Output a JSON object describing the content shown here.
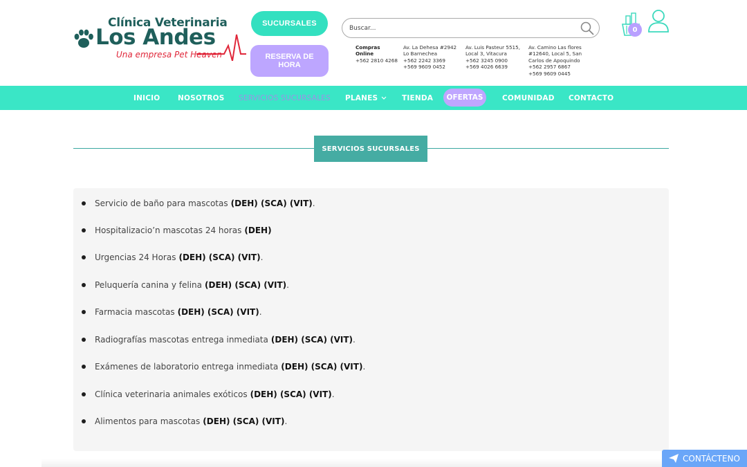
{
  "brand": {
    "line1": "Clínica Veterinaria",
    "line2": "Los Andes",
    "tagline": "Una empresa Pet Heaven",
    "colors": {
      "teal": "#1f5f5b",
      "accent_red": "#e0273a",
      "mint": "#3ae6c6",
      "lavender": "#bda6ff"
    }
  },
  "header": {
    "sucursales_label": "SUCURSALES",
    "reserva_label": "RESERVA DE HORA",
    "search_placeholder": "Buscar...",
    "cart_count": "0",
    "contacts": [
      {
        "lines": [
          "Compras",
          "Online"
        ],
        "bold_lines": 2,
        "extra": [
          "+562 2810 4268"
        ]
      },
      {
        "lines": [
          "Av. La Dehesa #2942",
          "Lo Barnechea",
          "+562 2242 3369",
          "+569 9609 0452"
        ]
      },
      {
        "lines": [
          "Av. Luis Pasteur 5515,",
          "Local 3, Vitacura",
          "+562 3245 0900",
          "+569 4026 6639"
        ]
      },
      {
        "lines": [
          "Av. Camino Las flores",
          "#12640, Local 5, San",
          "Carlos de Apoquindo",
          "+562 2957 6867",
          "+569 9609 0445"
        ]
      }
    ]
  },
  "nav": {
    "items": [
      {
        "label": "INICIO"
      },
      {
        "label": "NOSOTROS"
      },
      {
        "label": "SERVICIOS SUCURSALES"
      },
      {
        "label": "PLANES"
      },
      {
        "label": "TIENDA"
      },
      {
        "label": "OFERTAS"
      },
      {
        "label": "COMUNIDAD"
      },
      {
        "label": "CONTACTO"
      }
    ]
  },
  "section": {
    "title": "SERVICIOS SUCURSALES"
  },
  "services": [
    {
      "text": "Servicio de baño para mascotas",
      "codes": "(DEH) (SCA) (VIT)",
      "suffix": "."
    },
    {
      "text": "Hospitalizacio’n mascotas 24 horas",
      "codes": "(DEH)",
      "suffix": ""
    },
    {
      "text": "Urgencias 24 Horas",
      "codes": "(DEH) (SCA) (VIT)",
      "suffix": "."
    },
    {
      "text": "Peluquería canina y felina",
      "codes": "(DEH) (SCA) (VIT)",
      "suffix": "."
    },
    {
      "text": "Farmacia mascotas",
      "codes": "(DEH) (SCA) (VIT)",
      "suffix": "."
    },
    {
      "text": "Radiografías mascotas entrega inmediata",
      "codes": "(DEH) (SCA) (VIT)",
      "suffix": "."
    },
    {
      "text": "Exámenes de laboratorio entrega inmediata",
      "codes": "(DEH) (SCA) (VIT)",
      "suffix": "."
    },
    {
      "text": "Clínica veterinaria animales exóticos",
      "codes": "(DEH) (SCA) (VIT)",
      "suffix": "."
    },
    {
      "text": "Alimentos para mascotas",
      "codes": "(DEH) (SCA) (VIT)",
      "suffix": "."
    }
  ],
  "floating": {
    "contact_label": "CONTÁCTENO"
  }
}
